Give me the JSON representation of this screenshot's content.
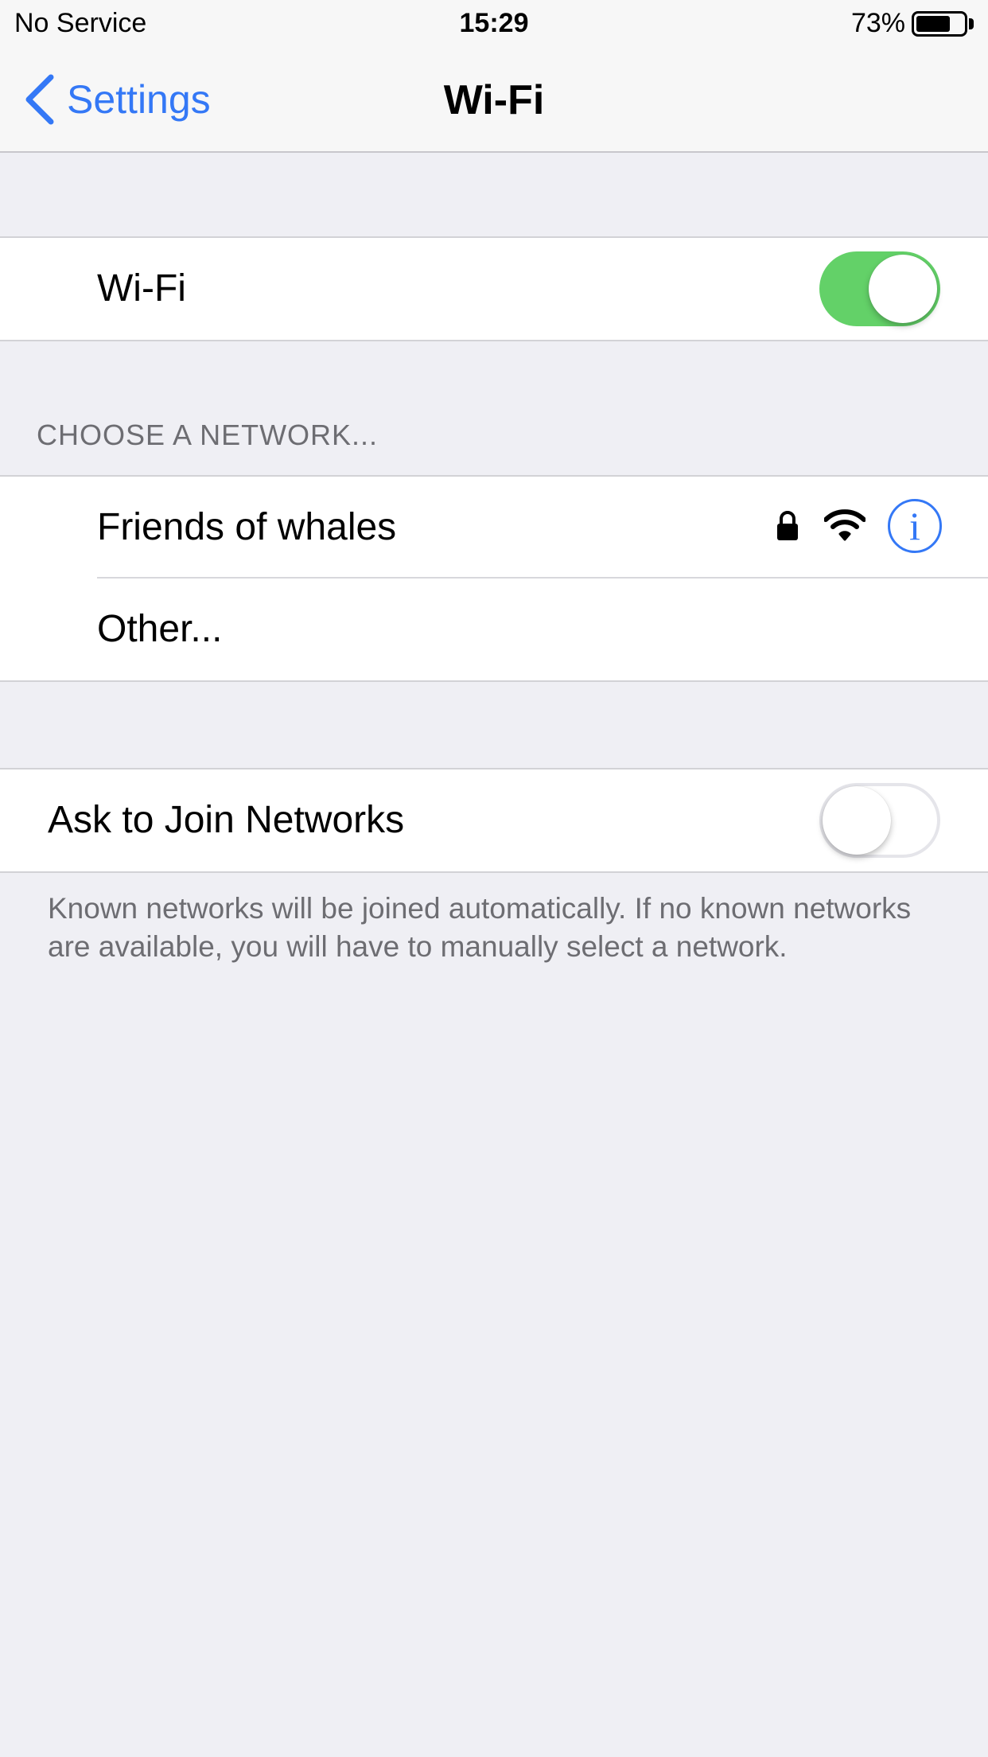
{
  "status_bar": {
    "carrier": "No Service",
    "time": "15:29",
    "battery_percent": "73%",
    "battery_level": 0.73
  },
  "nav": {
    "back_label": "Settings",
    "title": "Wi-Fi"
  },
  "wifi_toggle": {
    "label": "Wi-Fi",
    "on": true
  },
  "networks": {
    "header": "CHOOSE A NETWORK...",
    "items": [
      {
        "name": "Friends of whales",
        "secured": true,
        "icons": [
          "lock-icon",
          "wifi-signal-icon",
          "info-icon"
        ]
      },
      {
        "name": "Other..."
      }
    ]
  },
  "ask_to_join": {
    "label": "Ask to Join Networks",
    "on": false,
    "footer": "Known networks will be joined automatically. If no known networks are available, you will have to manually select a network."
  },
  "colors": {
    "accent": "#3478f6",
    "toggle_on": "#63d168",
    "background": "#efeff4",
    "secondary_text": "#6d6d72"
  }
}
